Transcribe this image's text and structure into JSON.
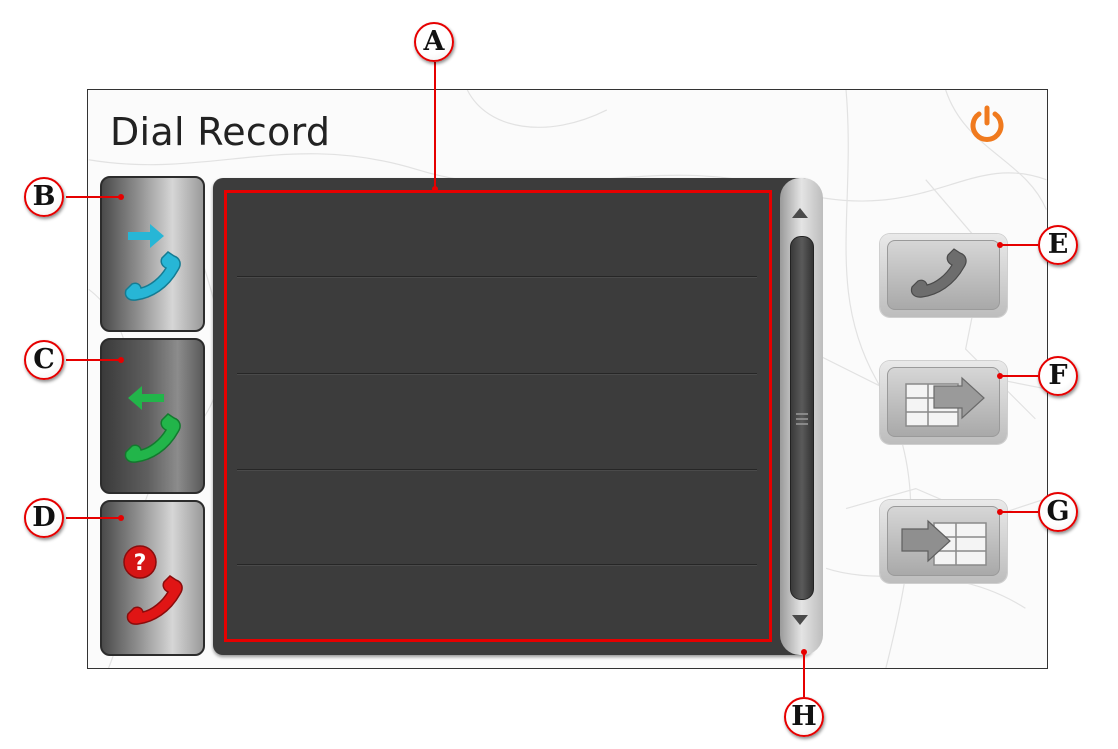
{
  "screen": {
    "title": "Dial Record"
  },
  "tabs": [
    {
      "id": "dialed",
      "icon": "outgoing-call-icon",
      "color": "#27b6d6"
    },
    {
      "id": "received",
      "icon": "incoming-call-icon",
      "color": "#22b54a"
    },
    {
      "id": "missed",
      "icon": "missed-call-icon",
      "color": "#e01515"
    }
  ],
  "right_buttons": [
    {
      "id": "call",
      "icon": "phone-handset-icon"
    },
    {
      "id": "export",
      "icon": "export-to-list-icon"
    },
    {
      "id": "import",
      "icon": "import-to-list-icon"
    }
  ],
  "callouts": {
    "a": "A",
    "b": "B",
    "c": "C",
    "d": "D",
    "e": "E",
    "f": "F",
    "g": "G",
    "h": "H"
  },
  "colors": {
    "callout": "#e60000",
    "power": "#f07a1e",
    "panel": "#3c3c3c"
  }
}
